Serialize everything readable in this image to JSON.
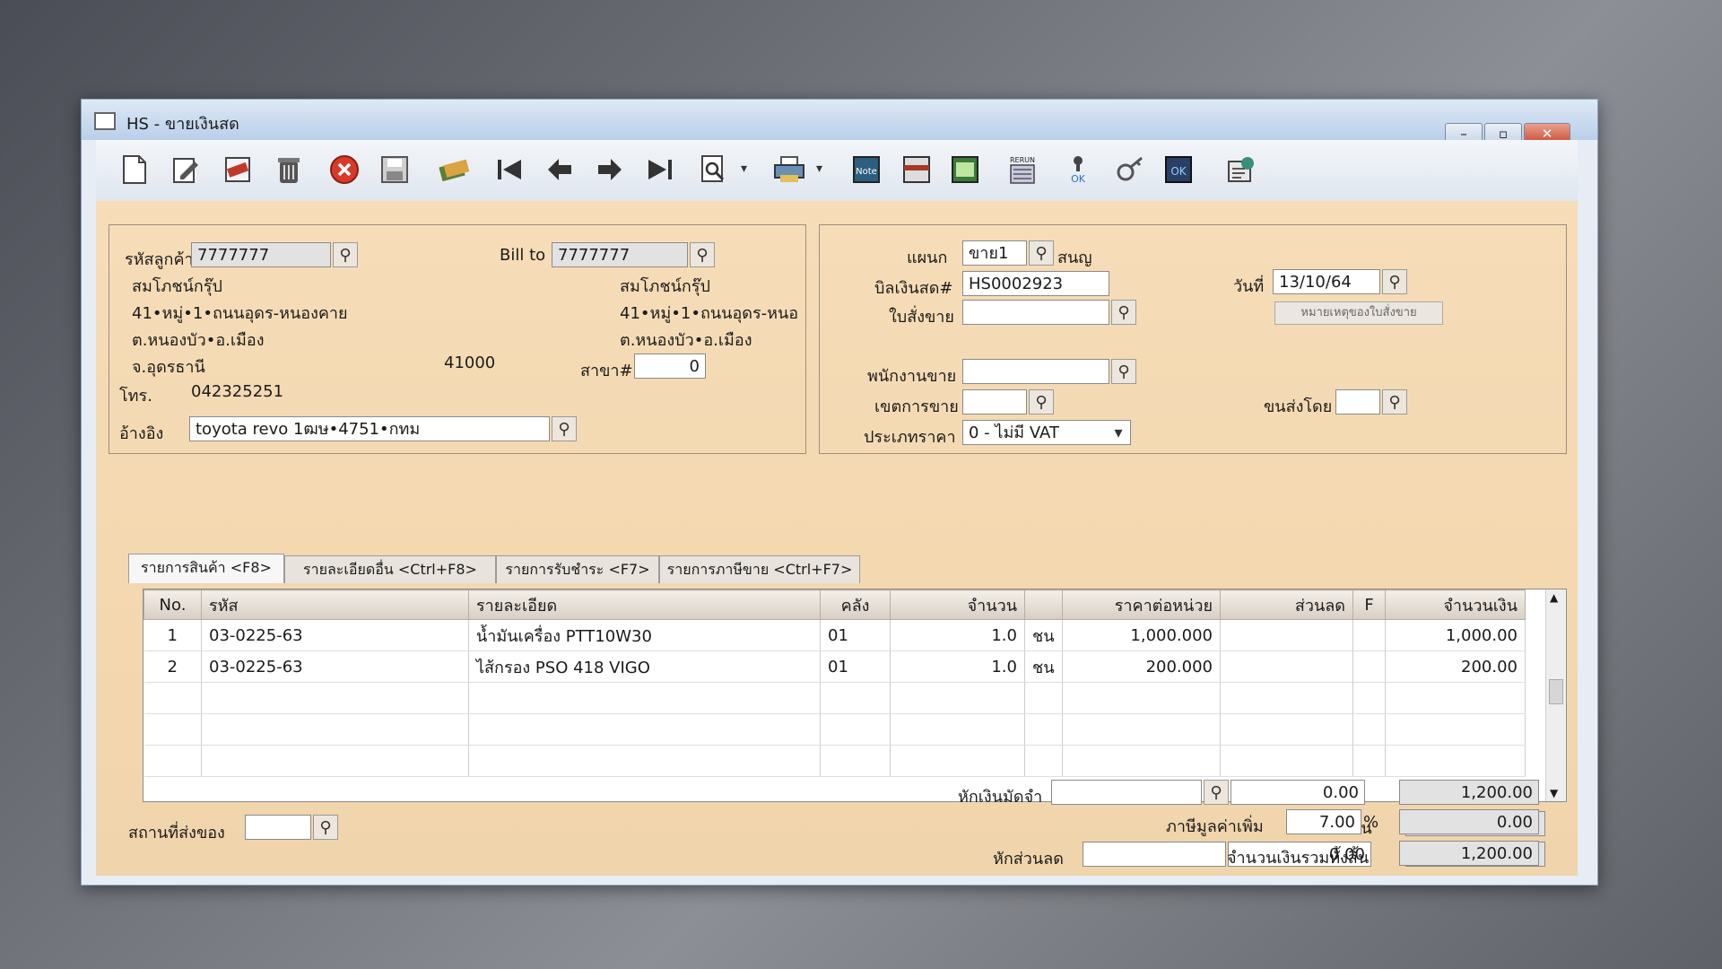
{
  "window": {
    "title": "HS - ขายเงินสด"
  },
  "toolbar": {
    "icons": [
      "new-icon",
      "edit-icon",
      "void-icon",
      "delete-icon",
      "cancel-icon",
      "save-icon",
      "copy-icon",
      "first-icon",
      "prev-icon",
      "next-icon",
      "last-icon",
      "search-icon",
      "print-icon",
      "note-icon",
      "form-icon",
      "money-icon",
      "rerun-icon",
      "approve-icon",
      "key-icon",
      "ok-icon",
      "settings-icon"
    ],
    "rerun_text": "RERUN",
    "ok_text": "OK",
    "note_text": "Note"
  },
  "customer": {
    "code_label": "รหัสลูกค้า",
    "code": "7777777",
    "name": "สมโภชน์กรุ๊ป",
    "address1": "41•หมู่•1•ถนนอุดร-หนองคาย",
    "address2": "ต.หนองบัว•อ.เมือง",
    "province": "จ.อุดรธานี",
    "postcode": "41000",
    "phone_label": "โทร.",
    "phone": "042325251",
    "ref_label": "อ้างอิง",
    "ref": "toyota revo 1ฒษ•4751•กทม"
  },
  "billto": {
    "label": "Bill to",
    "code": "7777777",
    "name": "สมโภชน์กรุ๊ป",
    "address1": "41•หมู่•1•ถนนอุดร-หนอ",
    "address2": "ต.หนองบัว•อ.เมือง",
    "branch_label": "สาขา#",
    "branch": "0"
  },
  "doc": {
    "dept_label": "แผนก",
    "dept": "ขาย1",
    "dept_name": "สนญ",
    "bill_label": "บิลเงินสด#",
    "bill": "HS0002923",
    "date_label": "วันที่",
    "date": "13/10/64",
    "so_label": "ใบสั่งขาย",
    "so": "",
    "so_note_button": "หมายเหตุของใบสั่งขาย",
    "salesman_label": "พนักงานขาย",
    "salesman": "",
    "area_label": "เขตการขาย",
    "area": "",
    "ship_label": "ขนส่งโดย",
    "ship": "",
    "price_type_label": "ประเภทราคา",
    "price_type": "0 - ไม่มี VAT"
  },
  "tabs": [
    {
      "label": "รายการสินค้า <F8>"
    },
    {
      "label": "รายละเอียดอื่น <Ctrl+F8>"
    },
    {
      "label": "รายการรับชำระ <F7>"
    },
    {
      "label": "รายการภาษีขาย <Ctrl+F7>"
    }
  ],
  "grid": {
    "columns": [
      "No.",
      "รหัส",
      "รายละเอียด",
      "คลัง",
      "จำนวน",
      "",
      "ราคาต่อหน่วย",
      "ส่วนลด",
      "F",
      "จำนวนเงิน"
    ],
    "rows": [
      {
        "no": "1",
        "code": "03-0225-63",
        "desc": "น้ำมันเครื่อง PTT10W30",
        "wh": "01",
        "qty": "1.0",
        "unit": "ชน",
        "price": "1,000.000",
        "disc": "",
        "f": "",
        "amount": "1,000.00"
      },
      {
        "no": "2",
        "code": "03-0225-63",
        "desc": "ไส้กรอง PSO 418 VIGO",
        "wh": "01",
        "qty": "1.0",
        "unit": "ชน",
        "price": "200.000",
        "disc": "",
        "f": "",
        "amount": "200.00"
      }
    ]
  },
  "delivery": {
    "label": "สถานที่ส่งของ",
    "value": ""
  },
  "totals": {
    "amount_label": "จำนวนเงิน",
    "amount": "1,200.00",
    "discount_label": "หักส่วนลด",
    "discount_text": "",
    "discount_value": "0.00",
    "after_discount": "1,200.00",
    "deposit_label": "หักเงินมัดจำ",
    "deposit_text": "",
    "deposit_value": "0.00",
    "after_deposit": "1,200.00",
    "vat_label": "ภาษีมูลค่าเพิ่ม",
    "vat_rate": "7.00",
    "vat_unit": "%",
    "vat_amount": "0.00",
    "grand_label": "จำนวนเงินรวมทั้งสิ้น",
    "grand": "1,200.00"
  }
}
